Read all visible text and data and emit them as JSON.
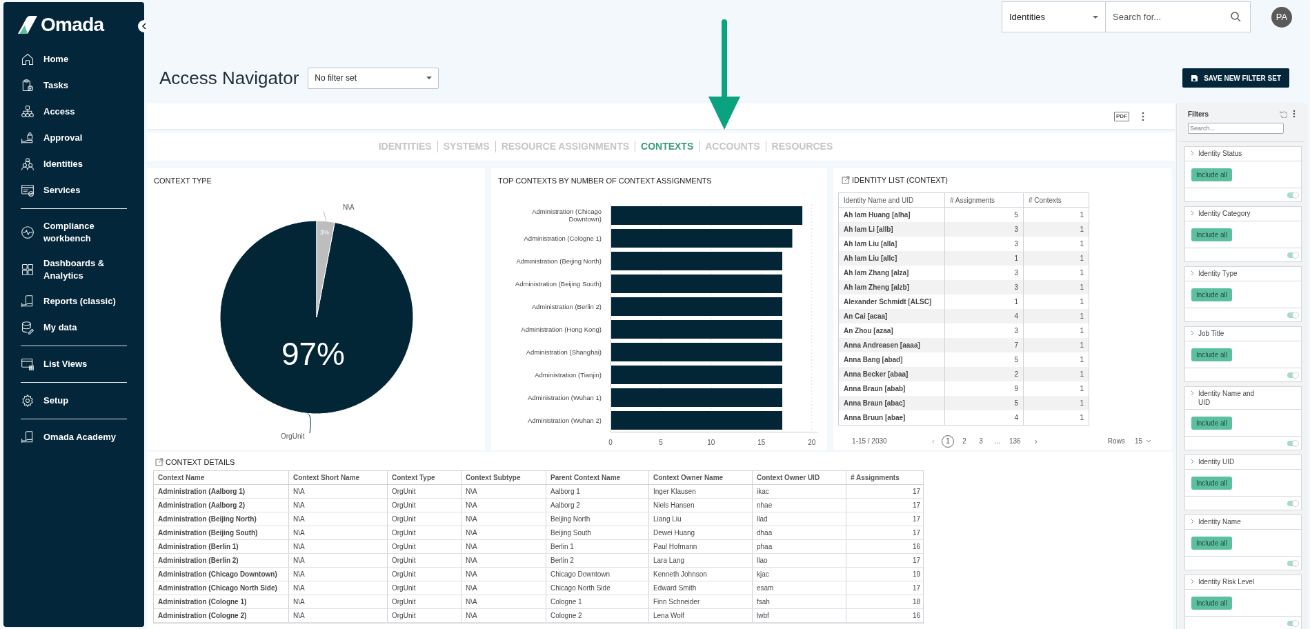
{
  "sidebar": {
    "logo": "Omada",
    "groups": [
      [
        {
          "label": "Home"
        },
        {
          "label": "Tasks"
        },
        {
          "label": "Access"
        },
        {
          "label": "Approval"
        },
        {
          "label": "Identities"
        },
        {
          "label": "Services"
        }
      ],
      [
        {
          "label": "Compliance workbench"
        },
        {
          "label": "Dashboards & Analytics"
        },
        {
          "label": "Reports (classic)"
        },
        {
          "label": "My data"
        }
      ],
      [
        {
          "label": "List Views"
        }
      ],
      [
        {
          "label": "Setup"
        }
      ],
      [
        {
          "label": "Omada Academy"
        }
      ]
    ]
  },
  "topbar": {
    "scope": "Identities",
    "search_placeholder": "Search for...",
    "avatar": "PA"
  },
  "page": {
    "title": "Access Navigator",
    "filter_set": "No filter set",
    "save_button": "SAVE NEW FILTER SET"
  },
  "report": {
    "export_label": "PDF",
    "tabs": [
      {
        "label": "IDENTITIES",
        "selected": false
      },
      {
        "label": "SYSTEMS",
        "selected": false
      },
      {
        "label": "RESOURCE ASSIGNMENTS",
        "selected": false
      },
      {
        "label": "CONTEXTS",
        "selected": true
      },
      {
        "label": "ACCOUNTS",
        "selected": false
      },
      {
        "label": "RESOURCES",
        "selected": false
      }
    ],
    "context_type": {
      "title": "CONTEXT TYPE",
      "chart_data": {
        "type": "pie",
        "categories": [
          "OrgUnit",
          "N\\A"
        ],
        "values": [
          97,
          3
        ],
        "value_labels": [
          "97%",
          "3%"
        ]
      }
    },
    "top_contexts": {
      "title": "TOP CONTEXTS BY NUMBER OF CONTEXT ASSIGNMENTS",
      "chart_data": {
        "type": "bar",
        "orientation": "horizontal",
        "categories": [
          "Administration (Chicago Downtown)",
          "Administration (Cologne 1)",
          "Administration (Beijing North)",
          "Administration (Beijing South)",
          "Administration (Berlin 2)",
          "Administration (Hong Kong)",
          "Administration (Shanghai)",
          "Administration (Tianjin)",
          "Administration (Wuhan 1)",
          "Administration (Wuhan 2)"
        ],
        "values": [
          19,
          18,
          17,
          17,
          17,
          17,
          17,
          17,
          17,
          17
        ],
        "xlim": [
          0,
          20.5
        ],
        "xticks": [
          0,
          5,
          10,
          15,
          20
        ],
        "grid": true
      }
    },
    "identity_list": {
      "title": "IDENTITY LIST (CONTEXT)",
      "columns": [
        "Identity Name and UID",
        "# Assignments",
        "# Contexts"
      ],
      "rows": [
        [
          "Ah Iam Huang [alha]",
          "5",
          "1"
        ],
        [
          "Ah Iam Li [allb]",
          "3",
          "1"
        ],
        [
          "Ah Iam Liu [alla]",
          "3",
          "1"
        ],
        [
          "Ah Iam Liu [allc]",
          "1",
          "1"
        ],
        [
          "Ah Iam Zhang [alza]",
          "3",
          "1"
        ],
        [
          "Ah Iam Zheng [alzb]",
          "3",
          "1"
        ],
        [
          "Alexander Schmidt [ALSC]",
          "1",
          "1"
        ],
        [
          "An Cai [acaa]",
          "4",
          "1"
        ],
        [
          "An Zhou [azaa]",
          "3",
          "1"
        ],
        [
          "Anna Andreasen [aaaa]",
          "7",
          "1"
        ],
        [
          "Anna Bang [abad]",
          "5",
          "1"
        ],
        [
          "Anna Becker [abaa]",
          "2",
          "1"
        ],
        [
          "Anna Braun [abab]",
          "9",
          "1"
        ],
        [
          "Anna Braun [abac]",
          "5",
          "1"
        ],
        [
          "Anna Bruun [abae]",
          "4",
          "1"
        ]
      ],
      "pagination": {
        "range": "1-15 / 2030",
        "prev": "‹",
        "next": "›",
        "pages": [
          {
            "label": "1",
            "selected": true
          },
          {
            "label": "2",
            "selected": false
          },
          {
            "label": "3",
            "selected": false
          },
          {
            "label": "...",
            "selected": false
          },
          {
            "label": "136",
            "selected": false
          }
        ],
        "rows_label": "Rows",
        "rows_value": "15"
      }
    },
    "context_details": {
      "title": "CONTEXT DETAILS",
      "columns": [
        "Context Name",
        "Context Short Name",
        "Context Type",
        "Context Subtype",
        "Parent Context Name",
        "Context Owner Name",
        "Context Owner UID",
        "# Assignments"
      ],
      "rows": [
        [
          "Administration (Aalborg 1)",
          "N\\A",
          "OrgUnit",
          "N\\A",
          "Aalborg 1",
          "Inger Klausen",
          "ikac",
          "17"
        ],
        [
          "Administration (Aalborg 2)",
          "N\\A",
          "OrgUnit",
          "N\\A",
          "Aalborg 2",
          "Niels Hansen",
          "nhae",
          "17"
        ],
        [
          "Administration (Beijing North)",
          "N\\A",
          "OrgUnit",
          "N\\A",
          "Beijing North",
          "Liang Liu",
          "llad",
          "17"
        ],
        [
          "Administration (Beijing South)",
          "N\\A",
          "OrgUnit",
          "N\\A",
          "Beijing South",
          "Dewei Huang",
          "dhaa",
          "17"
        ],
        [
          "Administration (Berlin 1)",
          "N\\A",
          "OrgUnit",
          "N\\A",
          "Berlin 1",
          "Paul Hofmann",
          "phaa",
          "16"
        ],
        [
          "Administration (Berlin 2)",
          "N\\A",
          "OrgUnit",
          "N\\A",
          "Berlin 2",
          "Lara Lang",
          "llao",
          "17"
        ],
        [
          "Administration (Chicago Downtown)",
          "N\\A",
          "OrgUnit",
          "N\\A",
          "Chicago Downtown",
          "Kenneth Johnson",
          "kjac",
          "19"
        ],
        [
          "Administration (Chicago North Side)",
          "N\\A",
          "OrgUnit",
          "N\\A",
          "Chicago North Side",
          "Edward Smith",
          "esam",
          "17"
        ],
        [
          "Administration (Cologne 1)",
          "N\\A",
          "OrgUnit",
          "N\\A",
          "Cologne 1",
          "Finn Schneider",
          "fsah",
          "18"
        ],
        [
          "Administration (Cologne 2)",
          "N\\A",
          "OrgUnit",
          "N\\A",
          "Cologne 2",
          "Lena Wolf",
          "lwbf",
          "16"
        ]
      ]
    }
  },
  "filters": {
    "title": "Filters",
    "search_placeholder": "Search...",
    "items": [
      {
        "label": "Identity Status",
        "chip": "Include all",
        "on": true
      },
      {
        "label": "Identity Category",
        "chip": "Include all",
        "on": true
      },
      {
        "label": "Identity Type",
        "chip": "Include all",
        "on": true
      },
      {
        "label": "Job Title",
        "chip": "Include all",
        "on": true
      },
      {
        "label": "Identity Name and UID",
        "chip": "Include all",
        "on": true
      },
      {
        "label": "Identity UID",
        "chip": "Include all",
        "on": true
      },
      {
        "label": "Identity Name",
        "chip": "Include all",
        "on": true
      },
      {
        "label": "Identity Risk Level",
        "chip": "Include all",
        "on": true
      }
    ]
  }
}
